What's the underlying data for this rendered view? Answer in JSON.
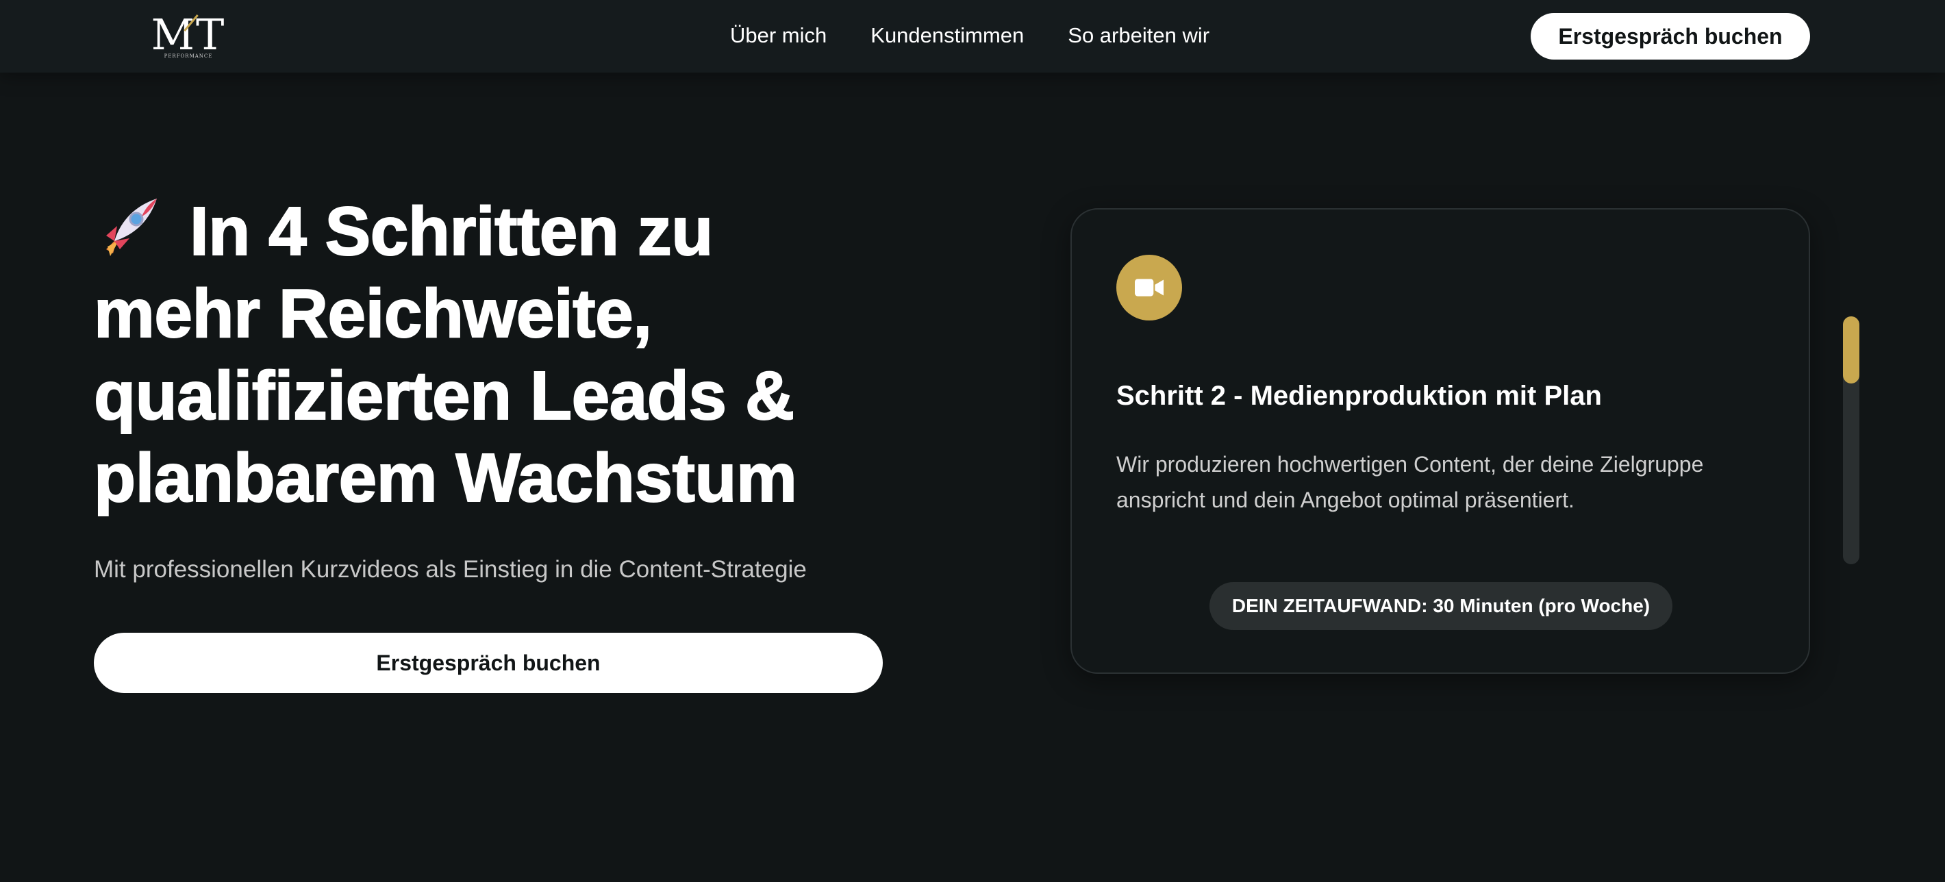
{
  "nav": {
    "logo_text": "MT",
    "logo_subtext": "PERFORMANCE",
    "links": [
      {
        "label": "Über mich"
      },
      {
        "label": "Kundenstimmen"
      },
      {
        "label": "So arbeiten wir"
      }
    ],
    "cta_label": "Erstgespräch buchen"
  },
  "hero": {
    "headline_lines": [
      "In 4 Schritten zu",
      "mehr Reichweite,",
      "qualifizierten Leads &",
      "planbarem Wachstum"
    ],
    "headline_icon": "rocket-icon",
    "subheadline": "Mit professionellen Kurzvideos als Einstieg in die Content-Strategie",
    "cta_label": "Erstgespräch buchen"
  },
  "step_card": {
    "icon": "video-camera-icon",
    "title": "Schritt 2 - Medienproduktion mit Plan",
    "text": "Wir produzieren hochwertigen Content, der deine Zielgruppe anspricht und dein Angebot optimal präsentiert.",
    "badge": "DEIN ZEITAUFWAND: 30 Minuten (pro Woche)"
  },
  "steps_progress": {
    "visible_fraction": 0.27
  },
  "colors": {
    "background": "#111516",
    "accent": "#c9a84f",
    "card_border": "#2b3133",
    "badge_bg": "#2a2f30"
  }
}
